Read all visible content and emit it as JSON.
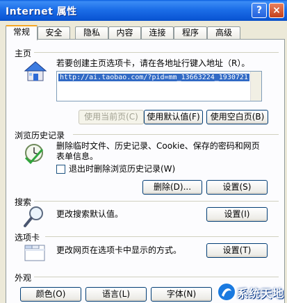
{
  "window": {
    "title": "Internet 属性",
    "help_label": "?",
    "close_label": "×"
  },
  "tabs": [
    {
      "label": "常规",
      "active": true
    },
    {
      "label": "安全",
      "active": false
    },
    {
      "label": "隐私",
      "active": false
    },
    {
      "label": "内容",
      "active": false
    },
    {
      "label": "连接",
      "active": false
    },
    {
      "label": "程序",
      "active": false
    },
    {
      "label": "高级",
      "active": false
    }
  ],
  "home": {
    "section_label": "主页",
    "description": "若要创建主页选项卡，请在各地址行键入地址（R）。",
    "url_value": "http://ai.taobao.com/?pid=mm_13663224_1930721",
    "use_current_label": "使用当前页(C)",
    "use_default_label": "使用默认值(F)",
    "use_blank_label": "使用空白页(B)"
  },
  "history": {
    "section_label": "浏览历史记录",
    "description_line1": "删除临时文件、历史记录、Cookie、保存的密码和网页",
    "description_line2": "表单信息。",
    "checkbox_label": "退出时删除浏览历史记录(W)",
    "delete_label": "删除(D)...",
    "settings_label": "设置(S)"
  },
  "search": {
    "section_label": "搜索",
    "description": "更改搜索默认值。",
    "settings_label": "设置(I)"
  },
  "tabs_section": {
    "section_label": "选项卡",
    "description": "更改网页在选项卡中显示的方式。",
    "settings_label": "设置(T)"
  },
  "appearance": {
    "section_label": "外观",
    "colors_label": "颜色(O)",
    "languages_label": "语言(L)",
    "fonts_label": "字体(N)"
  },
  "watermark": {
    "text": "系统天地"
  },
  "colors": {
    "titlebar": "#0b57d6",
    "dialog_bg": "#ece9d8",
    "panel_bg": "#fcfcfe",
    "active_tab_accent": "#f5a623",
    "selection": "#316ac5"
  }
}
